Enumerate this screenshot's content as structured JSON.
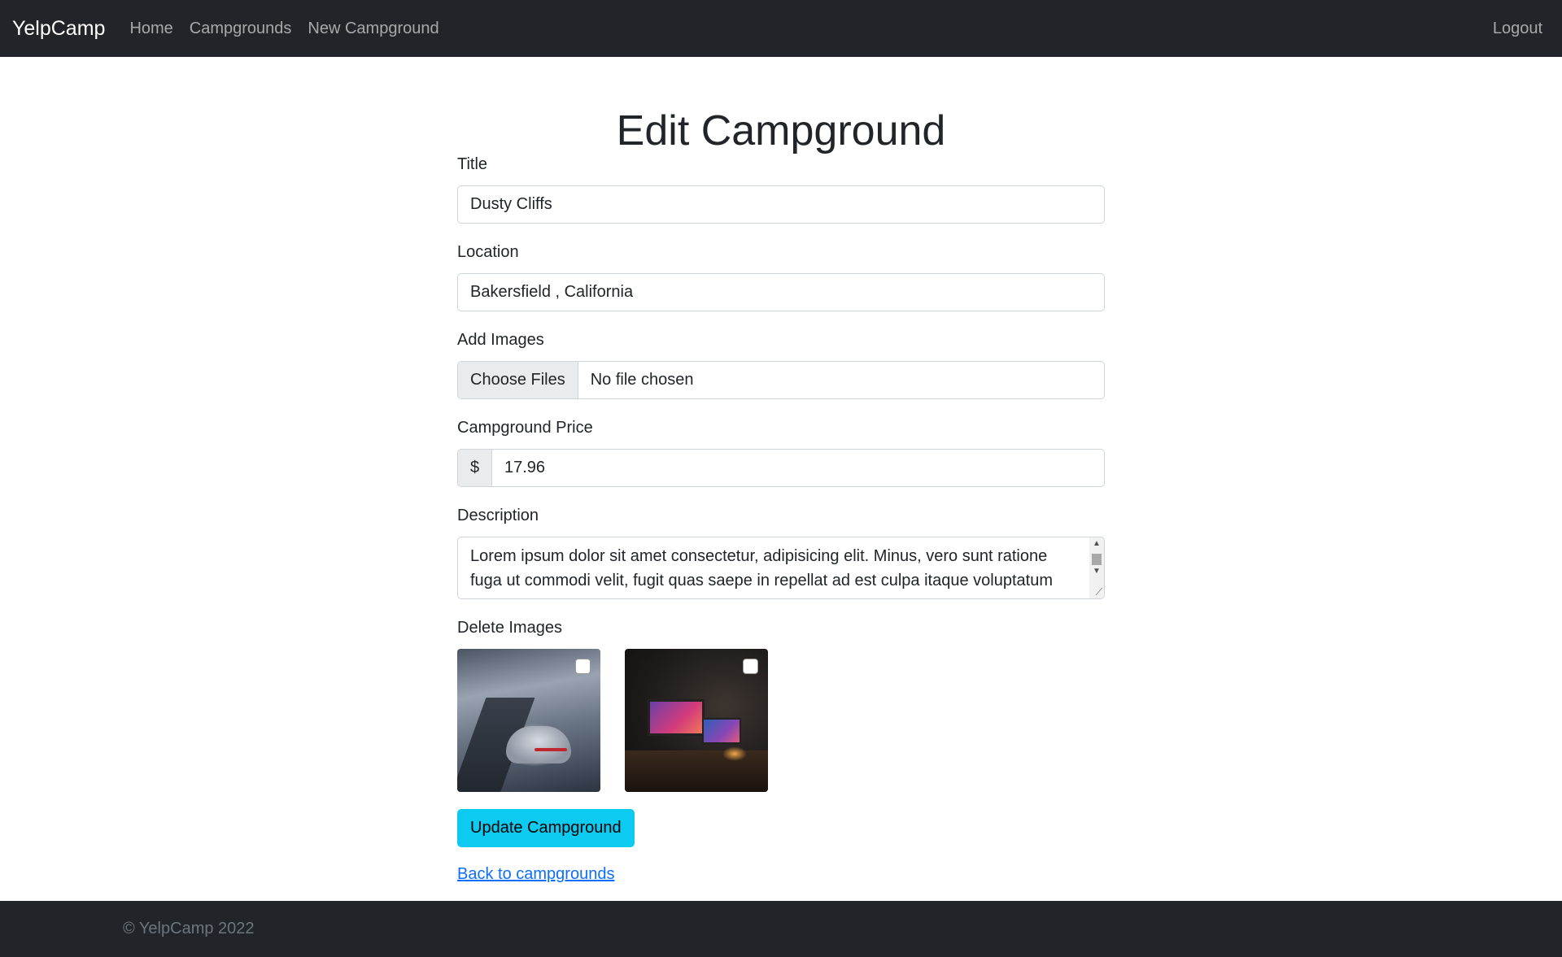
{
  "nav": {
    "brand": "YelpCamp",
    "links": [
      "Home",
      "Campgrounds",
      "New Campground"
    ],
    "logout": "Logout"
  },
  "page": {
    "title": "Edit Campground"
  },
  "form": {
    "title_label": "Title",
    "title_value": "Dusty Cliffs",
    "location_label": "Location",
    "location_value": "Bakersfield , California",
    "images_label": "Add Images",
    "file_button": "Choose Files",
    "file_status": "No file chosen",
    "price_label": "Campground Price",
    "price_addon": "$",
    "price_value": "17.96",
    "description_label": "Description",
    "description_value": " Lorem ipsum dolor sit amet consectetur, adipisicing elit. Minus, vero sunt ratione fuga ut commodi velit, fugit quas saepe in repellat ad est culpa itaque voluptatum",
    "delete_images_label": "Delete Images",
    "submit_label": "Update Campground",
    "back_link": "Back to campgrounds"
  },
  "footer": {
    "text": "© YelpCamp 2022"
  },
  "colors": {
    "navbar": "#212529",
    "accent_button": "#0dcaf0",
    "link": "#0d6efd"
  }
}
